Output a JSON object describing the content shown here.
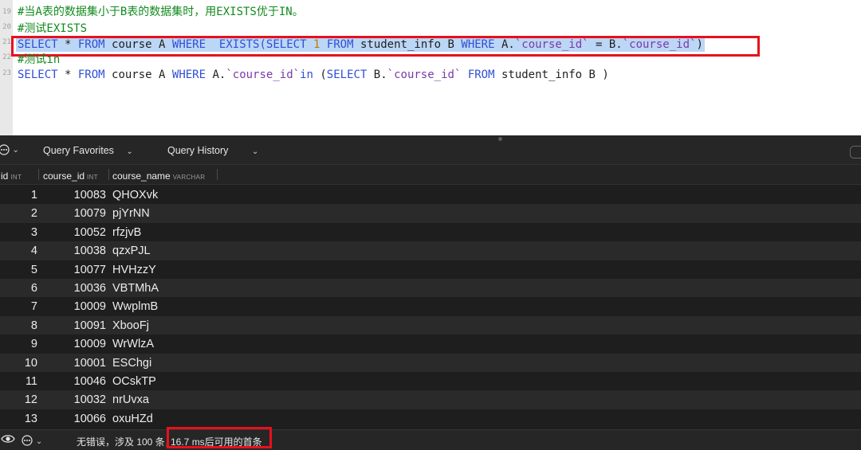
{
  "editor": {
    "line_numbers": [
      "19",
      "20",
      "21",
      "22",
      "23"
    ],
    "line1_comment": "#当A表的数据集小于B表的数据集时，用EXISTS优于IN。",
    "line2_comment": "#测试EXISTS",
    "line3": {
      "t1": "SELECT",
      "t2": " * ",
      "t3": "FROM",
      "t4": " course A ",
      "t5": "WHERE",
      "t6": "  ",
      "t7": "EXISTS",
      "t8": "(",
      "t9": "SELECT",
      "t10": " ",
      "t11": "1",
      "t12": " ",
      "t13": "FROM",
      "t14": " student_info B ",
      "t15": "WHERE",
      "t16": " A.",
      "t17": "`course_id`",
      "t18": " = B.",
      "t19": "`course_id`",
      "t20": ")"
    },
    "line4_comment": "#测试in",
    "line5": {
      "t1": "SELECT",
      "t2": " * ",
      "t3": "FROM",
      "t4": " course A ",
      "t5": "WHERE",
      "t6": " A.",
      "t7": "`course_id`",
      "t8": "in",
      "t9": " (",
      "t10": "SELECT",
      "t11": " B.",
      "t12": "`course_id`",
      "t13": " ",
      "t14": "FROM",
      "t15": " student_info B )"
    }
  },
  "toolbar": {
    "favorites_label": "Query Favorites",
    "history_label": "Query History"
  },
  "table": {
    "columns": [
      {
        "name": "id",
        "type": "INT"
      },
      {
        "name": "course_id",
        "type": "INT"
      },
      {
        "name": "course_name",
        "type": "VARCHAR"
      }
    ],
    "rows": [
      {
        "id": "1",
        "course_id": "10083",
        "course_name": "QHOXvk"
      },
      {
        "id": "2",
        "course_id": "10079",
        "course_name": "pjYrNN"
      },
      {
        "id": "3",
        "course_id": "10052",
        "course_name": "rfzjvB"
      },
      {
        "id": "4",
        "course_id": "10038",
        "course_name": "qzxPJL"
      },
      {
        "id": "5",
        "course_id": "10077",
        "course_name": "HVHzzY"
      },
      {
        "id": "6",
        "course_id": "10036",
        "course_name": "VBTMhA"
      },
      {
        "id": "7",
        "course_id": "10009",
        "course_name": "WwplmB"
      },
      {
        "id": "8",
        "course_id": "10091",
        "course_name": "XbooFj"
      },
      {
        "id": "9",
        "course_id": "10009",
        "course_name": "WrWlzA"
      },
      {
        "id": "10",
        "course_id": "10001",
        "course_name": "ESChgi"
      },
      {
        "id": "11",
        "course_id": "10046",
        "course_name": "OCskTP"
      },
      {
        "id": "12",
        "course_id": "10032",
        "course_name": "nrUvxa"
      },
      {
        "id": "13",
        "course_id": "10066",
        "course_name": "oxuHZd"
      }
    ]
  },
  "status": {
    "summary": "无错误，涉及 100 条，",
    "timing": "16.7 ms后可用的首条"
  },
  "icons": {
    "eye": "eye-icon",
    "options": "ellipsis-circle-icon",
    "chevron": "chevron-down-icon"
  },
  "colors": {
    "highlight_box": "#e8101c",
    "selection": "#bcd6f5",
    "comment": "#128a1e",
    "keyword": "#2f4fd8"
  }
}
